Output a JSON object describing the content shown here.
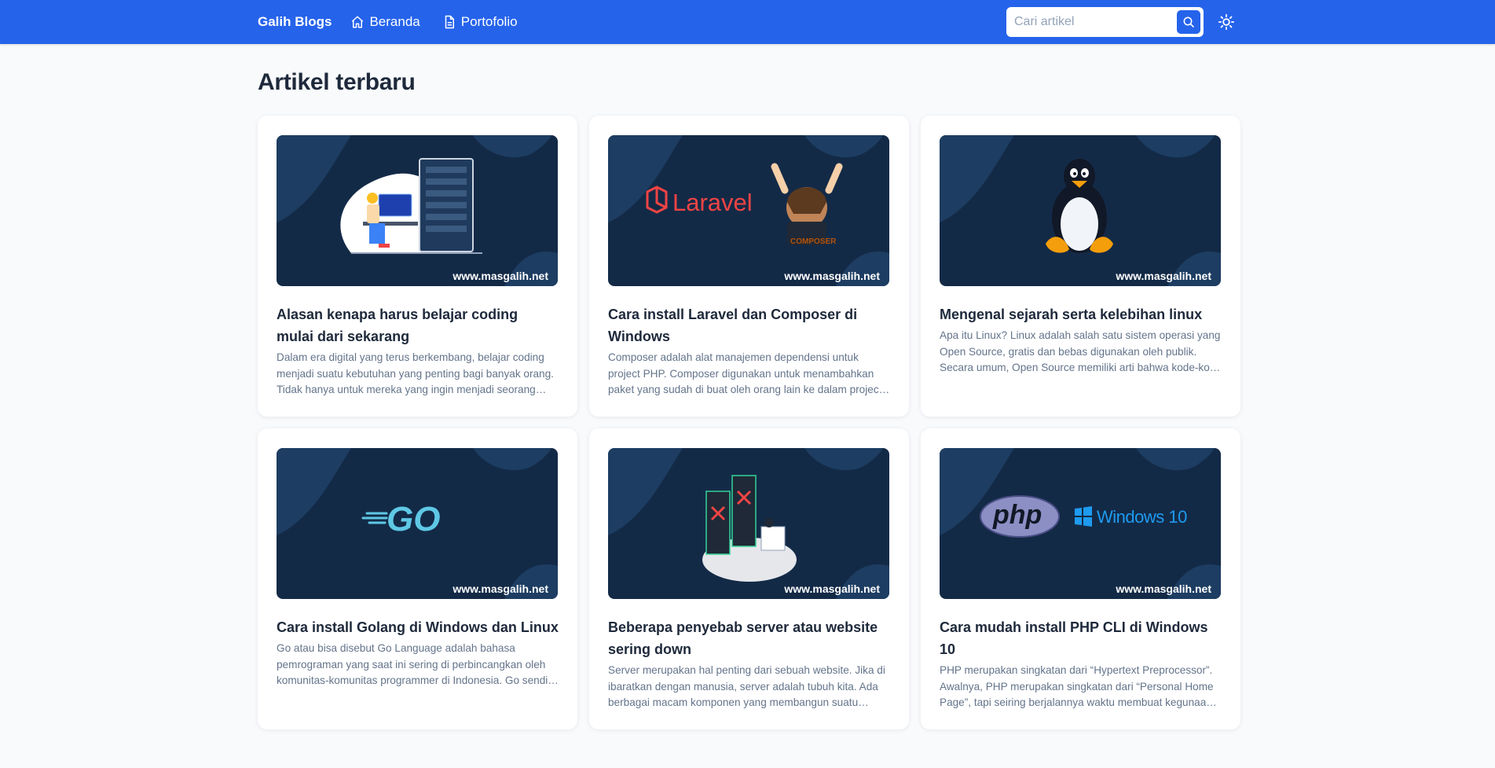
{
  "header": {
    "brand": "Galih Blogs",
    "nav": [
      {
        "label": "Beranda",
        "icon": "home-icon"
      },
      {
        "label": "Portofolio",
        "icon": "document-icon"
      }
    ],
    "search_placeholder": "Cari artikel",
    "search_value": "",
    "theme_icon": "sun-icon",
    "accent": "#2563eb"
  },
  "main": {
    "title": "Artikel terbaru",
    "articles": [
      {
        "title": "Alasan kenapa harus belajar coding mulai dari sekarang",
        "excerpt": "Dalam era digital yang terus berkembang, belajar coding menjadi suatu kebutuhan yang penting bagi banyak orang. Tidak hanya untuk mereka yang ingin menjadi seorang programmer",
        "watermark": "www.masgalih.net"
      },
      {
        "title": "Cara install Laravel dan Composer di Windows",
        "excerpt": "Composer adalah alat manajemen dependensi untuk project PHP. Composer digunakan untuk menambahkan paket yang sudah di buat oleh orang lain ke dalam project kita. Composer",
        "watermark": "www.masgalih.net",
        "image_text": {
          "laravel": "Laravel",
          "composer": "COMPOSER"
        }
      },
      {
        "title": "Mengenal sejarah serta kelebihan linux",
        "excerpt": "Apa itu Linux? Linux adalah salah satu sistem operasi yang Open Source, gratis dan bebas digunakan oleh publik. Secara umum, Open Source memiliki arti bahwa kode-kode yang digunakan",
        "watermark": "www.masgalih.net"
      },
      {
        "title": "Cara install Golang di Windows dan Linux",
        "excerpt": "Go atau bisa disebut Go Language adalah bahasa pemrograman yang saat ini sering di perbincangkan oleh komunitas-komunitas programmer di Indonesia. Go sendiri dikembangkan",
        "watermark": "www.masgalih.net",
        "image_text": {
          "go": "GO"
        }
      },
      {
        "title": "Beberapa penyebab server atau website sering down",
        "excerpt": "Server merupakan hal penting dari sebuah website. Jika di ibaratkan dengan manusia, server adalah tubuh kita. Ada berbagai macam komponen yang membangun suatu server",
        "watermark": "www.masgalih.net"
      },
      {
        "title": "Cara mudah install PHP CLI di Windows 10",
        "excerpt": "PHP merupakan singkatan dari “Hypertext Preprocessor”. Awalnya, PHP merupakan singkatan dari “Personal Home Page”, tapi seiring berjalannya waktu membuat kegunaan dari PHP",
        "watermark": "www.masgalih.net",
        "image_text": {
          "php": "php",
          "windows": "Windows 10"
        }
      }
    ]
  },
  "colors": {
    "thumb_bg": "#132a47",
    "thumb_blob": "#1d3d62",
    "page_bg": "#f8fafc"
  }
}
